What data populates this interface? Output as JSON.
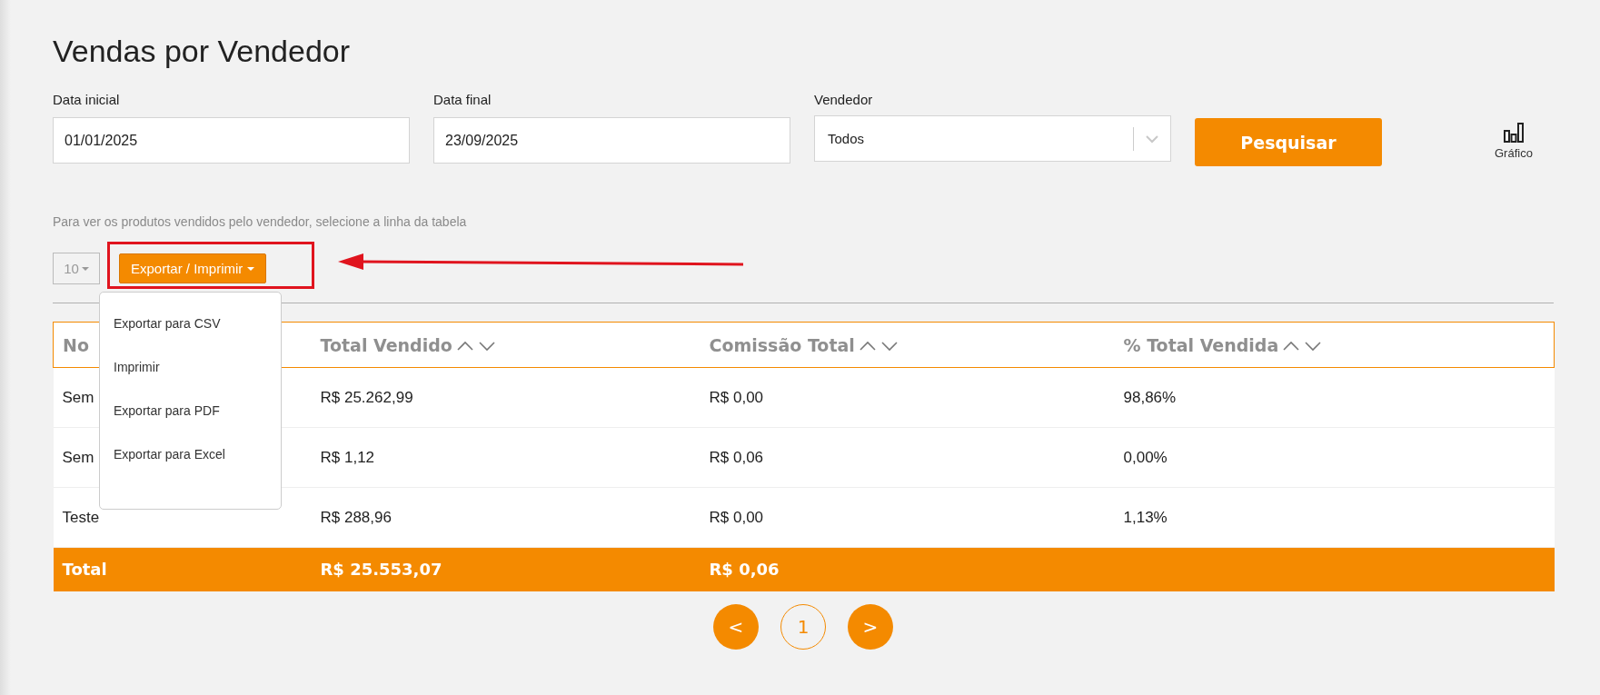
{
  "title": "Vendas por Vendedor",
  "filters": [
    {
      "kind": "date",
      "label": "Data inicial",
      "value": "01/01/2025"
    },
    {
      "kind": "date",
      "label": "Data final",
      "value": "23/09/2025"
    },
    {
      "kind": "select",
      "label": "Vendedor",
      "value": "Todos"
    }
  ],
  "search_button": "Pesquisar",
  "chart_button": "Gráfico",
  "hint": "Para ver os produtos vendidos pelo vendedor, selecione a linha da tabela",
  "page_size": "10",
  "export_button": "Exportar / Imprimir",
  "export_menu": [
    "Exportar para CSV",
    "Imprimir",
    "Exportar para PDF",
    "Exportar para Excel"
  ],
  "table": {
    "columns": [
      {
        "label": "No",
        "sortable": false
      },
      {
        "label": "Total Vendido",
        "sortable": true
      },
      {
        "label": "Comissão Total",
        "sortable": true
      },
      {
        "label": "% Total Vendida",
        "sortable": true
      }
    ],
    "rows": [
      [
        "Sem",
        "R$ 25.262,99",
        "R$ 0,00",
        "98,86%"
      ],
      [
        "Sem",
        "R$ 1,12",
        "R$ 0,06",
        "0,00%"
      ],
      [
        "Teste",
        "R$ 288,96",
        "R$ 0,00",
        "1,13%"
      ]
    ],
    "total": [
      "Total",
      "R$ 25.553,07",
      "R$ 0,06"
    ]
  },
  "pagination": {
    "prev": "<",
    "pages": [
      {
        "label": "1",
        "selected": true
      }
    ],
    "next": ">"
  }
}
